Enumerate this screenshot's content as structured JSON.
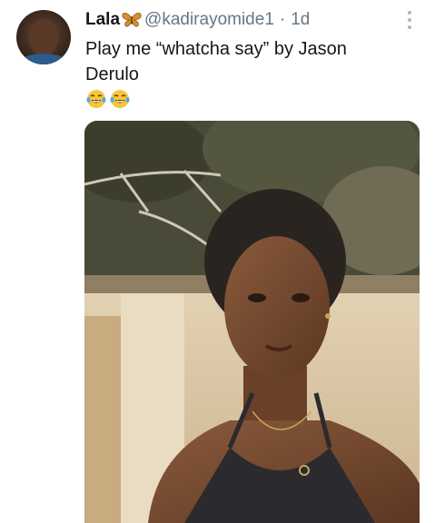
{
  "tweet": {
    "display_name": "Lala",
    "handle": "@kadirayomide1",
    "separator": "·",
    "time": "1d",
    "text": "Play me “whatcha say” by Jason Derulo",
    "emojis": [
      "laughing-tears-icon",
      "laughing-tears-icon"
    ]
  },
  "icons": {
    "name_badge": "butterfly-icon",
    "menu": "more-vertical-icon"
  },
  "colors": {
    "text_primary": "#14171a",
    "text_secondary": "#657786",
    "butterfly": "#d9902b",
    "emoji": "#f7c53b"
  }
}
